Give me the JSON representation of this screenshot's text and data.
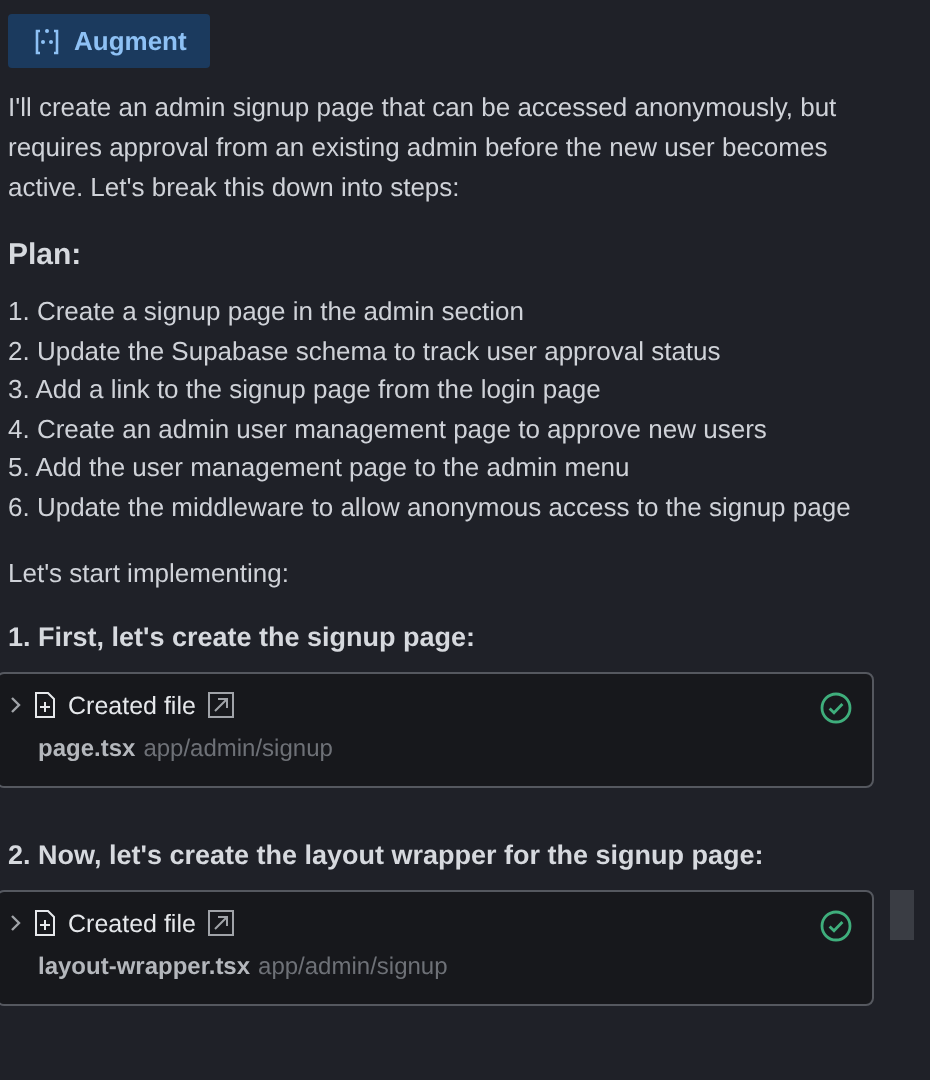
{
  "badge": {
    "label": "Augment"
  },
  "intro": "I'll create an admin signup page that can be accessed anonymously, but requires approval from an existing admin before the new user becomes active. Let's break this down into steps:",
  "plan_heading": "Plan:",
  "plan_items": [
    "1. Create a signup page in the admin section",
    "2. Update the Supabase schema to track user approval status",
    "3. Add a link to the signup page from the login page",
    "4. Create an admin user management page to approve new users",
    "5. Add the user management page to the admin menu",
    "6. Update the middleware to allow anonymous access to the signup page"
  ],
  "lead": "Let's start implementing:",
  "steps": [
    {
      "heading": "1. First, let's create the signup page:",
      "card": {
        "title": "Created file",
        "file": "page.tsx",
        "path": "app/admin/signup",
        "done": true
      }
    },
    {
      "heading": "2. Now, let's create the layout wrapper for the signup page:",
      "card": {
        "title": "Created file",
        "file": "layout-wrapper.tsx",
        "path": "app/admin/signup",
        "done": true
      }
    }
  ]
}
